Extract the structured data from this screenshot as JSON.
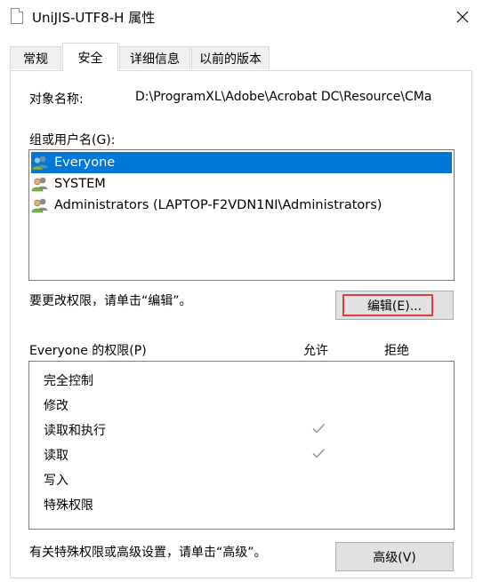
{
  "window": {
    "title": "UniJIS-UTF8-H 属性",
    "close_icon": "close-icon"
  },
  "tabs": [
    {
      "label": "常规",
      "active": false
    },
    {
      "label": "安全",
      "active": true
    },
    {
      "label": "详细信息",
      "active": false
    },
    {
      "label": "以前的版本",
      "active": false
    }
  ],
  "security": {
    "object_name_label": "对象名称:",
    "object_name_value": "D:\\ProgramXL\\Adobe\\Acrobat DC\\Resource\\CMa",
    "groups_label": "组或用户名(G):",
    "users": [
      {
        "name": "Everyone",
        "selected": true,
        "icon": "user-group-icon"
      },
      {
        "name": "SYSTEM",
        "selected": false,
        "icon": "user-group-icon"
      },
      {
        "name": "Administrators (LAPTOP-F2VDN1NI\\Administrators)",
        "selected": false,
        "icon": "user-group-icon"
      }
    ],
    "change_hint": "要更改权限，请单击“编辑”。",
    "edit_button": "编辑(E)...",
    "permissions_label": "Everyone 的权限(P)",
    "allow_header": "允许",
    "deny_header": "拒绝",
    "permissions": [
      {
        "name": "完全控制",
        "allow": false,
        "deny": false
      },
      {
        "name": "修改",
        "allow": false,
        "deny": false
      },
      {
        "name": "读取和执行",
        "allow": true,
        "deny": false
      },
      {
        "name": "读取",
        "allow": true,
        "deny": false
      },
      {
        "name": "写入",
        "allow": false,
        "deny": false
      },
      {
        "name": "特殊权限",
        "allow": false,
        "deny": false
      }
    ],
    "advanced_hint": "有关特殊权限或高级设置，请单击“高级”。",
    "advanced_button": "高级(V)"
  },
  "colors": {
    "selection": "#0078d7",
    "highlight_border": "#e23b3b",
    "check_gray": "#9a9a9a"
  }
}
